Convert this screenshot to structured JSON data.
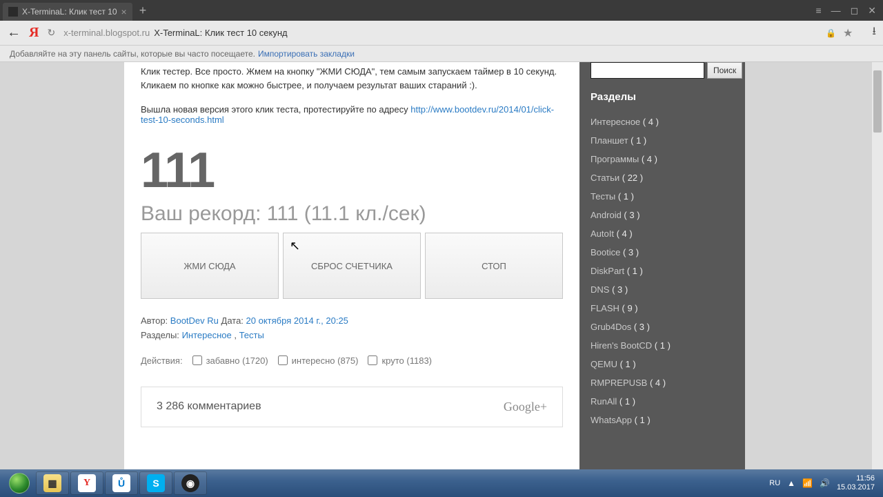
{
  "browser": {
    "tab_title": "X-TerminaL: Клик тест 10",
    "url_host": "x-terminal.blogspot.ru",
    "url_title": "X-TerminaL: Клик тест 10 секунд",
    "bookmarks_hint": "Добавляйте на эту панель сайты, которые вы часто посещаете.",
    "bookmarks_link": "Импортировать закладки"
  },
  "page": {
    "intro": "Клик тестер. Все просто. Жмем на кнопку \"ЖМИ СЮДА\", тем самым запускаем таймер в 10 секунд. Кликаем по кнопке как можно быстрее, и получаем результат ваших стараний :).",
    "newver_prefix": "Вышла новая версия этого клик теста, протестируйте по адресу ",
    "newver_link": "http://www.bootdev.ru/2014/01/click-test-10-seconds.html",
    "counter": "111",
    "record": "Ваш рекорд: 111 (11.1 кл./сек)",
    "btn_click": "ЖМИ СЮДА",
    "btn_reset": "СБРОС СЧЕТЧИКА",
    "btn_stop": "СТОП",
    "author_label": "Автор:",
    "author": "BootDev Ru",
    "date_label": "Дата:",
    "date": "20 октября 2014 г., 20:25",
    "sections_label": "Разделы:",
    "section1": "Интересное",
    "section2": "Тесты",
    "actions_label": "Действия:",
    "act1": "забавно (1720)",
    "act2": "интересно (875)",
    "act3": "круто (1183)",
    "comments": "3 286 комментариев",
    "gplus": "Google+"
  },
  "sidebar": {
    "search_btn": "Поиск",
    "heading": "Разделы",
    "cats": [
      {
        "name": "Интересное",
        "count": "( 4 )"
      },
      {
        "name": "Планшет",
        "count": "( 1 )"
      },
      {
        "name": "Программы",
        "count": "( 4 )"
      },
      {
        "name": "Статьи",
        "count": "( 22 )"
      },
      {
        "name": "Тесты",
        "count": "( 1 )"
      },
      {
        "name": "Android",
        "count": "( 3 )"
      },
      {
        "name": "AutoIt",
        "count": "( 4 )"
      },
      {
        "name": "Bootice",
        "count": "( 3 )"
      },
      {
        "name": "DiskPart",
        "count": "( 1 )"
      },
      {
        "name": "DNS",
        "count": "( 3 )"
      },
      {
        "name": "FLASH",
        "count": "( 9 )"
      },
      {
        "name": "Grub4Dos",
        "count": "( 3 )"
      },
      {
        "name": "Hiren's BootCD",
        "count": "( 1 )"
      },
      {
        "name": "QEMU",
        "count": "( 1 )"
      },
      {
        "name": "RMPREPUSB",
        "count": "( 4 )"
      },
      {
        "name": "RunAll",
        "count": "( 1 )"
      },
      {
        "name": "WhatsApp",
        "count": "( 1 )"
      }
    ]
  },
  "taskbar": {
    "lang": "RU",
    "time": "11:56",
    "date": "15.03.2017"
  }
}
